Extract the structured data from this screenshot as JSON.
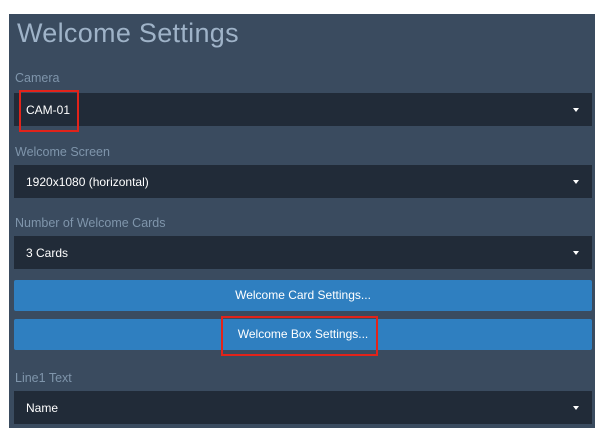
{
  "page": {
    "title": "Welcome Settings"
  },
  "camera": {
    "label": "Camera",
    "value": "CAM-01"
  },
  "welcome_screen": {
    "label": "Welcome Screen",
    "value": "1920x1080 (horizontal)"
  },
  "card_count": {
    "label": "Number of Welcome Cards",
    "value": "3 Cards"
  },
  "buttons": {
    "card_settings": "Welcome Card Settings...",
    "box_settings": "Welcome Box Settings..."
  },
  "line1": {
    "label": "Line1 Text",
    "value": "Name"
  },
  "colors": {
    "panel": "#3a4b5f",
    "field": "#212b38",
    "button": "#2f7fc0",
    "highlight": "#e2231a"
  }
}
